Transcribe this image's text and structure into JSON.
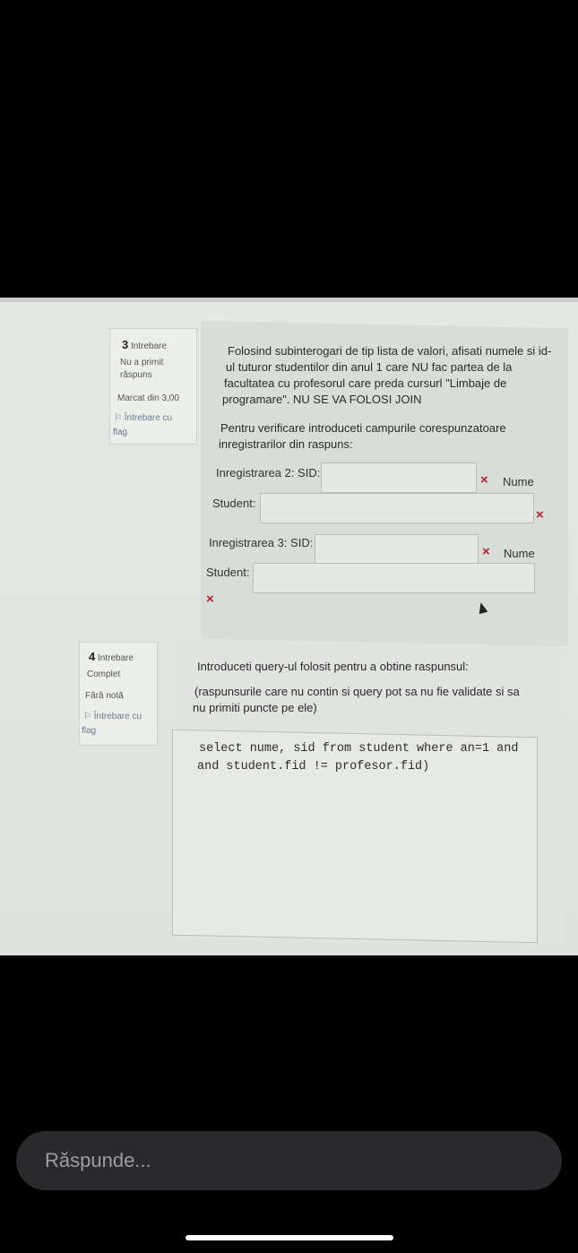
{
  "question3": {
    "number": "3",
    "label": "Intrebare",
    "status_line1": "Nu a primit",
    "status_line2": "răspuns",
    "marked": "Marcat din 3,00",
    "flag_line1": "Întrebare cu",
    "flag_line2": "flag",
    "text_lines": [
      "Folosind subinterogari de tip lista de valori, afisati numele si id-",
      "ul tuturor studentilor din anul 1 care NU fac partea de la",
      "facultatea cu profesorul care preda cursurl \"Limbaje de",
      "programare\". NU SE VA FOLOSI JOIN"
    ],
    "instruction_lines": [
      "Pentru verificare introduceti campurile corespunzatoare",
      "inregistrarilor din raspuns:"
    ],
    "record2": {
      "label": "Inregistrarea 2: SID:",
      "sid_value": "",
      "nume_label": "Nume",
      "student_label": "Student:",
      "student_value": ""
    },
    "record3": {
      "label": "Inregistrarea 3: SID:",
      "sid_value": "",
      "nume_label": "Nume",
      "student_label": "Student:",
      "student_value": ""
    },
    "error_mark": "×"
  },
  "question4": {
    "number": "4",
    "label": "Intrebare",
    "status": "Complet",
    "grade": "Fără notă",
    "flag_line1": "Întrebare cu",
    "flag_line2": "flag",
    "text_line1": "Introduceti query-ul folosit pentru a obtine raspunsul:",
    "text_line2": "(raspunsurile care nu contin si query pot sa nu fie validate si sa",
    "text_line3": "nu primiti puncte pe ele)",
    "answer_lines": [
      "select nume, sid from student where an=1 and",
      "and student.fid != profesor.fid)"
    ]
  },
  "reply": {
    "placeholder": "Răspunde..."
  }
}
